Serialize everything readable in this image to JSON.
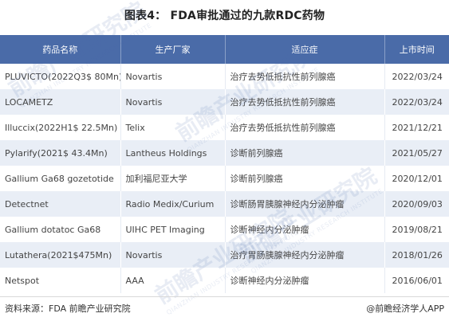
{
  "title": "图表4： FDA审批通过的九款RDC药物",
  "table": {
    "headers": [
      "药品名称",
      "生产厂家",
      "适应症",
      "上市时间"
    ],
    "rows": [
      [
        "PLUVICTO(2022Q3$ 80Mn)",
        "Novartis",
        "治疗去势低抵抗性前列腺癌",
        "2022/03/24"
      ],
      [
        "LOCAMETZ",
        "Novartis",
        "治疗去势低抵抗性前列腺癌",
        "2022/03/24"
      ],
      [
        "Illuccix(2022H1$ 22.5Mn)",
        "Telix",
        "治疗去势低抵抗性前列腺癌",
        "2021/12/21"
      ],
      [
        "Pylarify(2021$ 43.4Mn)",
        "Lantheus Holdings",
        "诊断前列腺癌",
        "2021/05/27"
      ],
      [
        "Gallium Ga68 gozetotide",
        "加利福尼亚大学",
        "诊断前列腺癌",
        "2020/12/01"
      ],
      [
        "Detectnet",
        "Radio Medix/Curium",
        "诊断肠胃胰腺神经内分泌肿瘤",
        "2020/09/03"
      ],
      [
        "Gallium dotatoc Ga68",
        "UIHC PET Imaging",
        "诊断神经内分泌肿瘤",
        "2019/08/21"
      ],
      [
        "Lutathera(2021$475Mn)",
        "Novartis",
        "治疗胃肠胰腺神经内分泌肿瘤",
        "2018/01/26"
      ],
      [
        "Netspot",
        "AAA",
        "诊断神经内分泌肿瘤",
        "2016/06/01"
      ]
    ]
  },
  "watermark": {
    "text": "前瞻产业研究院",
    "sub": "QIANZHAN INDUSTRY RESEARCH INSTITUTE"
  },
  "footer": {
    "source": "资料来源：FDA 前瞻产业研究院",
    "brand": "@前瞻经济学人APP"
  },
  "colors": {
    "header_bg": "#4a6ba8",
    "row_alt_bg": "#e9eef6",
    "text": "#444444"
  }
}
